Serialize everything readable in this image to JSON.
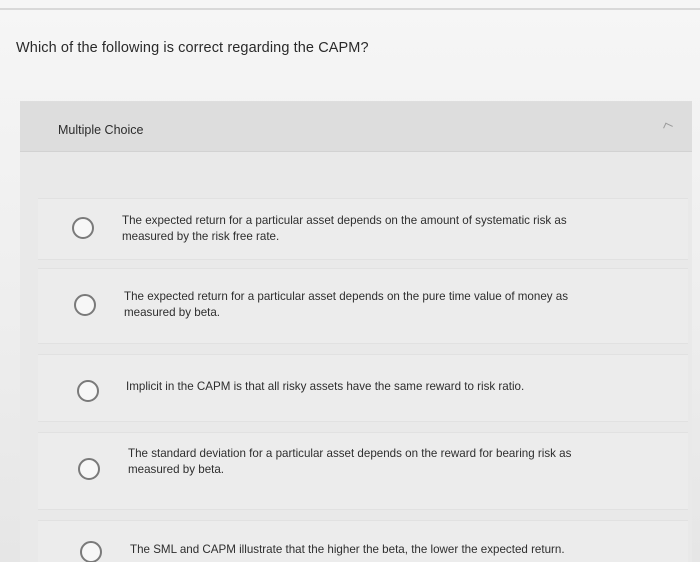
{
  "question": {
    "text": "Which of the following is correct regarding the CAPM?"
  },
  "card": {
    "header_label": "Multiple Choice"
  },
  "options": [
    {
      "text": "The expected return for a particular asset depends on the amount of systematic risk as measured by the risk free rate.",
      "selected": false
    },
    {
      "text": "The expected return for a particular asset depends on the pure time value of money as measured by beta.",
      "selected": false
    },
    {
      "text": "Implicit in the CAPM is that all risky assets have the same reward to risk ratio.",
      "selected": false
    },
    {
      "text": "The standard deviation for a particular asset depends on the reward for bearing risk as measured by beta.",
      "selected": false
    },
    {
      "text": "The SML and CAPM illustrate that the higher the beta, the lower the expected return.",
      "selected": false
    }
  ]
}
